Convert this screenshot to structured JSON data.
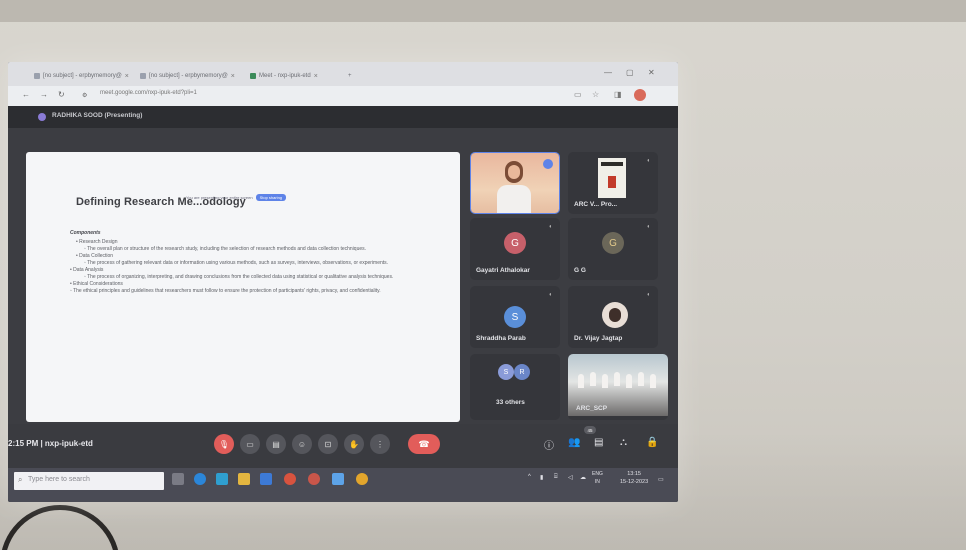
{
  "browser": {
    "tabs": [
      {
        "label": "[no subject] - erpbymemory@"
      },
      {
        "label": "[no subject] - erpbymemory@"
      },
      {
        "label": "Meet - nxp-ipuk-etd"
      }
    ],
    "new_tab": "+",
    "url": "meet.google.com/nxp-ipuk-etd?pli=1"
  },
  "meet": {
    "presenter_label": "RADHIKA SOOD (Presenting)",
    "meeting_time_code": "2:15 PM | nxp-ipuk-etd",
    "participant_count_badge": "45",
    "tiles": [
      {
        "name": "",
        "initial": ""
      },
      {
        "name": "ARC V...  Pro...",
        "initial": ""
      },
      {
        "name": "Gayatri Athalokar",
        "initial": "G"
      },
      {
        "name": "G G",
        "initial": "G"
      },
      {
        "name": "Shraddha Parab",
        "initial": "S"
      },
      {
        "name": "Dr. Vijay Jagtap",
        "initial": ""
      },
      {
        "name": "33 others",
        "initial": "S",
        "initial2": "R"
      },
      {
        "name": "ARC_SCP",
        "initial": ""
      }
    ],
    "colors": {
      "accent": "#5e83e8",
      "end_call": "#e25d5a"
    }
  },
  "slide": {
    "title": "Defining Research Me...odology",
    "share_notice": "You are presenting your entire screen",
    "stop_button": "Stop sharing",
    "heading": "Components",
    "lines": [
      {
        "level": 1,
        "text": "• Research Design"
      },
      {
        "level": 2,
        "text": "◦ The overall plan or structure of the research study, including the selection of research methods and data collection techniques."
      },
      {
        "level": 1,
        "text": "• Data Collection"
      },
      {
        "level": 2,
        "text": "◦ The process of gathering relevant data or information using various methods, such as surveys, interviews, observations, or experiments."
      },
      {
        "level": 1,
        "text": "• Data Analysis"
      },
      {
        "level": 2,
        "text": "◦ The process of organizing, interpreting, and drawing conclusions from the collected data using statistical or qualitative analysis techniques."
      },
      {
        "level": 1,
        "text": "• Ethical Considerations"
      },
      {
        "level": 2,
        "text": "◦ The ethical principles and guidelines that researchers must follow to ensure the protection of participants' rights, privacy, and confidentiality."
      }
    ]
  },
  "taskbar": {
    "search_placeholder": "Type here to search",
    "language": "ENG",
    "region": "IN",
    "time": "13:15",
    "date": "15-12-2023"
  }
}
